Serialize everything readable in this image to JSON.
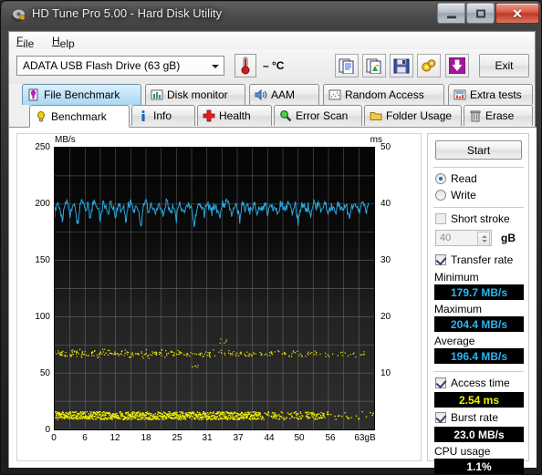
{
  "window": {
    "title": "HD Tune Pro 5.00 - Hard Disk Utility",
    "app_icon": "hdtune-disk-icon",
    "minimize": "─",
    "maximize": "□",
    "close": "✕"
  },
  "menu": {
    "file": "File",
    "help": "Help"
  },
  "toolbar": {
    "drive": "ADATA   USB Flash Drive  (63 gB)",
    "thermometer_icon": "thermometer-icon",
    "temperature": "– °C",
    "buttons": [
      {
        "name": "copy-text-button",
        "icon": "copy-text-icon"
      },
      {
        "name": "copy-image-button",
        "icon": "copy-image-icon"
      },
      {
        "name": "save-button",
        "icon": "floppy-save-icon"
      },
      {
        "name": "options-button",
        "icon": "gears-icon"
      },
      {
        "name": "download-button",
        "icon": "download-arrow-icon"
      }
    ],
    "exit": "Exit"
  },
  "tabs": {
    "row1": [
      {
        "label": "File Benchmark",
        "icon": "file-benchmark-icon",
        "selected": true
      },
      {
        "label": "Disk monitor",
        "icon": "bar-chart-icon",
        "selected": false
      },
      {
        "label": "AAM",
        "icon": "speaker-icon",
        "selected": false
      },
      {
        "label": "Random Access",
        "icon": "scatter-icon",
        "selected": false
      },
      {
        "label": "Extra tests",
        "icon": "extra-chart-icon",
        "selected": false
      }
    ],
    "row2": [
      {
        "label": "Benchmark",
        "icon": "lightbulb-icon",
        "selected": true
      },
      {
        "label": "Info",
        "icon": "info-icon",
        "selected": false
      },
      {
        "label": "Health",
        "icon": "red-cross-icon",
        "selected": false
      },
      {
        "label": "Error Scan",
        "icon": "magnifier-icon",
        "selected": false
      },
      {
        "label": "Folder Usage",
        "icon": "folder-icon",
        "selected": false
      },
      {
        "label": "Erase",
        "icon": "trash-icon",
        "selected": false
      }
    ]
  },
  "panel": {
    "start": "Start",
    "read": "Read",
    "write": "Write",
    "read_selected": true,
    "short_stroke": "Short stroke",
    "short_stroke_checked": false,
    "short_stroke_value": "40",
    "short_stroke_unit": "gB",
    "transfer_rate": "Transfer rate",
    "transfer_rate_checked": true,
    "minimum_label": "Minimum",
    "minimum_value": "179.7 MB/s",
    "maximum_label": "Maximum",
    "maximum_value": "204.4 MB/s",
    "average_label": "Average",
    "average_value": "196.4 MB/s",
    "access_time": "Access time",
    "access_time_checked": true,
    "access_time_value": "2.54 ms",
    "burst_rate": "Burst rate",
    "burst_rate_checked": true,
    "burst_rate_value": "23.0 MB/s",
    "cpu_usage_label": "CPU usage",
    "cpu_usage_value": "1.1%"
  },
  "colors": {
    "transfer_line": "#29a8e0",
    "access_dots": "#f2f200",
    "value_cyan": "#28b6f0",
    "value_yellow": "#f2f200",
    "value_white": "#ffffff",
    "plot_background": "#0a0a0a",
    "grid": "#8a8a8a"
  },
  "chart_data": {
    "type": "line",
    "title": "",
    "ylabel": "MB/s",
    "y2label": "ms",
    "xlabel": "",
    "ylim": [
      0,
      250
    ],
    "y2lim": [
      0,
      50
    ],
    "xlim": [
      0,
      63
    ],
    "yticks": [
      0,
      50,
      100,
      150,
      200,
      250
    ],
    "y2ticks": [
      10,
      20,
      30,
      40,
      50
    ],
    "xticks": [
      0,
      6,
      12,
      18,
      25,
      31,
      37,
      44,
      50,
      56,
      63
    ],
    "xticklabels": [
      "0",
      "6",
      "12",
      "18",
      "25",
      "31",
      "37",
      "44",
      "50",
      "56",
      "63gB"
    ],
    "grid": true,
    "legend": "none",
    "series": [
      {
        "name": "Transfer rate",
        "axis": "left",
        "unit": "MB/s",
        "color": "#29a8e0",
        "style": "line",
        "min": 179.7,
        "max": 204.4,
        "average": 196.4,
        "x": [
          0.0,
          0.5,
          1.0,
          1.5,
          2.0,
          2.5,
          3.0,
          3.5,
          4.0,
          4.5,
          5.0,
          5.5,
          6.0,
          6.5,
          7.0,
          7.5,
          8.0,
          8.5,
          9.0,
          9.5,
          10.0,
          10.5,
          11.0,
          11.5,
          12.0,
          12.5,
          13.0,
          13.5,
          14.0,
          14.5,
          15.0,
          15.5,
          16.0,
          16.5,
          17.0,
          17.5,
          18.0,
          18.5,
          19.0,
          19.5,
          20.0,
          20.5,
          21.0,
          21.5,
          22.0,
          22.5,
          23.0,
          23.5,
          24.0,
          24.5,
          25.0,
          25.5,
          26.0,
          26.5,
          27.0,
          27.5,
          28.0,
          28.5,
          29.0,
          29.5,
          30.0,
          30.5,
          31.0,
          31.5,
          32.0,
          32.5,
          33.0,
          33.5,
          34.0,
          34.5,
          35.0,
          35.5,
          36.0,
          36.5,
          37.0,
          37.5,
          38.0,
          38.5,
          39.0,
          39.5,
          40.0,
          40.5,
          41.0,
          41.5,
          42.0,
          42.5,
          43.0,
          43.5,
          44.0,
          44.5,
          45.0,
          45.5,
          46.0,
          46.5,
          47.0,
          47.5,
          48.0,
          48.5,
          49.0,
          49.5,
          50.0,
          50.5,
          51.0,
          51.5,
          52.0,
          52.5,
          53.0,
          53.5,
          54.0,
          54.5,
          55.0,
          55.5,
          56.0,
          56.5,
          57.0,
          57.5,
          58.0,
          58.5,
          59.0,
          59.5,
          60.0,
          60.5,
          61.0,
          61.5,
          62.0,
          62.5,
          63.0
        ],
        "y": [
          192.0,
          203.0,
          196.0,
          185.0,
          199.0,
          201.0,
          190.0,
          199.5,
          197.0,
          182.0,
          198.0,
          203.5,
          193.0,
          200.0,
          188.0,
          199.0,
          202.0,
          195.0,
          186.0,
          200.5,
          198.0,
          191.0,
          203.0,
          197.5,
          189.0,
          199.0,
          196.0,
          200.0,
          184.0,
          198.5,
          202.0,
          194.0,
          199.0,
          196.5,
          180.0,
          197.0,
          201.0,
          193.0,
          199.5,
          195.0,
          191.0,
          200.0,
          198.0,
          190.0,
          203.0,
          196.0,
          193.5,
          199.0,
          186.0,
          200.0,
          197.0,
          192.0,
          198.5,
          201.0,
          194.0,
          179.7,
          196.0,
          200.5,
          198.0,
          190.0,
          202.0,
          196.5,
          193.0,
          199.0,
          195.0,
          188.0,
          200.0,
          197.5,
          204.4,
          196.0,
          191.0,
          199.5,
          198.0,
          185.0,
          201.0,
          196.0,
          199.0,
          193.0,
          197.5,
          200.0,
          192.0,
          198.0,
          195.5,
          202.0,
          190.0,
          199.0,
          196.0,
          197.0,
          189.0,
          200.5,
          198.0,
          194.0,
          201.0,
          196.5,
          192.0,
          199.0,
          183.0,
          197.0,
          200.0,
          195.0,
          198.5,
          191.0,
          202.0,
          196.0,
          199.0,
          193.5,
          197.0,
          200.0,
          190.0,
          198.0,
          196.5,
          194.0,
          201.0,
          197.0,
          195.0,
          199.5,
          188.0,
          198.0,
          196.0,
          200.0,
          193.0,
          197.5,
          201.0,
          195.0,
          199.0
        ]
      },
      {
        "name": "Access time (scatter)",
        "axis": "right",
        "unit": "ms",
        "color": "#f2f200",
        "style": "scatter",
        "average": 2.54,
        "x": [
          0.4,
          0.8,
          1.3,
          1.9,
          2.4,
          3.1,
          3.7,
          4.2,
          5.0,
          5.8,
          7.2,
          7.8,
          8.3,
          8.9,
          9.6,
          10.4,
          11.0,
          11.7,
          12.5,
          13.3,
          14.1,
          14.8,
          15.6,
          16.4,
          17.2,
          18.0,
          19.1,
          19.8,
          20.6,
          21.4,
          22.3,
          23.1,
          24.0,
          24.8,
          25.7,
          26.5,
          27.4,
          28.2,
          29.1,
          30.0,
          31.0,
          32.0,
          33.1,
          34.2,
          35.0,
          36.0,
          37.1,
          38.2,
          39.0,
          41.0,
          42.2,
          43.4,
          44.6,
          46.0,
          47.5,
          49.0,
          50.5,
          52.0,
          54.0,
          56.5,
          58.5,
          61.0
        ],
        "y": [
          13.6,
          13.4,
          13.8,
          13.5,
          13.2,
          13.7,
          13.4,
          13.9,
          13.3,
          13.6,
          13.5,
          13.8,
          13.2,
          13.6,
          14.0,
          13.4,
          13.7,
          13.3,
          13.6,
          13.9,
          13.5,
          13.2,
          13.7,
          13.4,
          13.8,
          13.1,
          13.6,
          13.5,
          13.9,
          13.3,
          13.7,
          13.4,
          13.6,
          13.8,
          13.2,
          13.5,
          11.2,
          13.7,
          13.4,
          13.6,
          13.3,
          13.8,
          15.8,
          13.5,
          13.7,
          13.4,
          13.6,
          13.2,
          13.5,
          13.6,
          13.4,
          13.8,
          13.5,
          13.3,
          13.6,
          13.2,
          13.5,
          13.7,
          13.4,
          13.6,
          13.3,
          13.5
        ]
      },
      {
        "name": "Access time (dense band)",
        "axis": "right",
        "unit": "ms",
        "color": "#f2f200",
        "style": "band",
        "value": 2.54,
        "spread": 0.35
      }
    ]
  }
}
